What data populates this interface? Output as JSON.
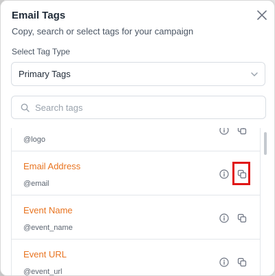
{
  "modal": {
    "title": "Email Tags",
    "subtitle": "Copy, search or select tags for your campaign",
    "close_icon": "close-icon"
  },
  "tag_type": {
    "label": "Select Tag Type",
    "selected": "Primary Tags"
  },
  "search": {
    "placeholder": "Search tags",
    "value": ""
  },
  "tags": [
    {
      "name": "",
      "code": "@logo"
    },
    {
      "name": "Email Address",
      "code": "@email"
    },
    {
      "name": "Event Name",
      "code": "@event_name"
    },
    {
      "name": "Event URL",
      "code": "@event_url"
    }
  ],
  "colors": {
    "tag_name": "#e8731f",
    "highlight": "#e01515"
  },
  "icons": {
    "info": "info-icon",
    "copy": "copy-icon",
    "chevron": "chevron-down-icon",
    "search": "search-icon"
  }
}
